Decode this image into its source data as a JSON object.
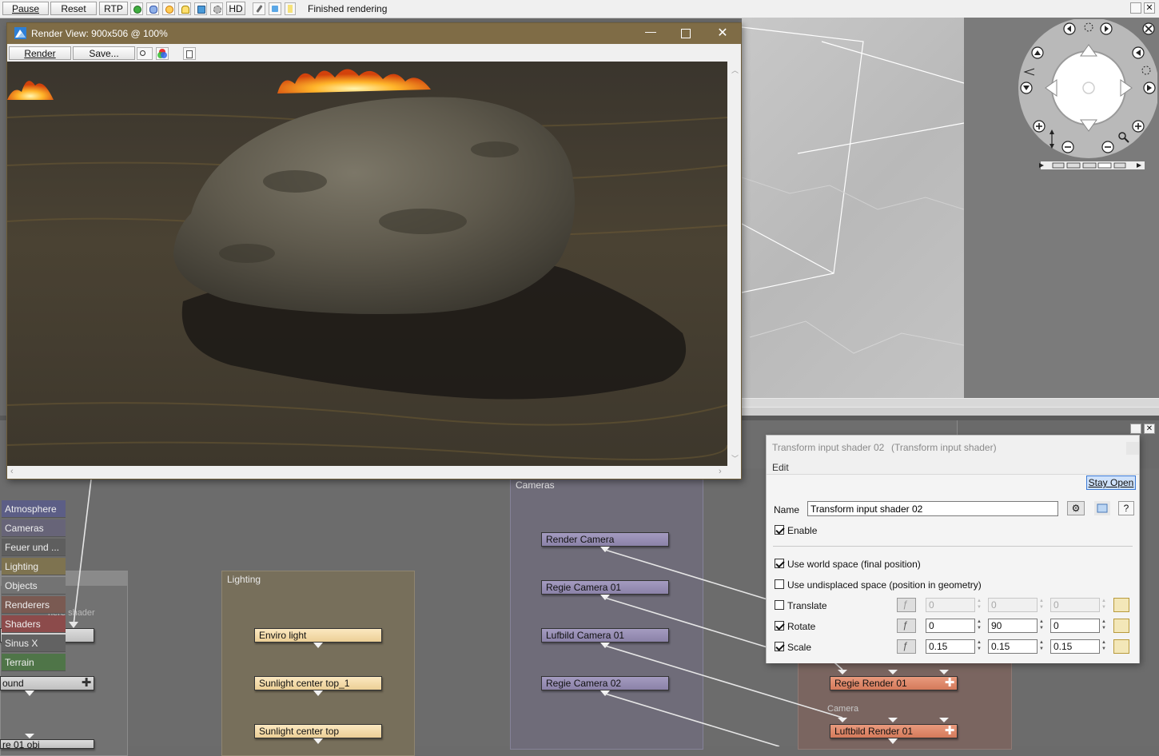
{
  "toolbar": {
    "pause_label": "Pause",
    "reset_label": "Reset",
    "rtp_label": "RTP",
    "hd_label": "HD",
    "status": "Finished rendering",
    "icons": [
      "globe-icon",
      "cloud-icon",
      "sun-icon",
      "light-bulb-icon",
      "material-icon",
      "gear-icon"
    ]
  },
  "render_view": {
    "title": "Render View: 900x506 @ 100%",
    "render_label": "Render",
    "save_label": "Save..."
  },
  "categories": [
    {
      "label": "Atmosphere",
      "color": "#5c5e86"
    },
    {
      "label": "Cameras",
      "color": "#676478"
    },
    {
      "label": "Feuer und ...",
      "color": "#5e5e5e"
    },
    {
      "label": "Lighting",
      "color": "#7e7350"
    },
    {
      "label": "Objects",
      "color": "#737373"
    },
    {
      "label": "Renderers",
      "color": "#7a5a52"
    },
    {
      "label": "Shaders",
      "color": "#8c4b4b"
    },
    {
      "label": "Sinus X",
      "color": "#626262"
    },
    {
      "label": "Terrain",
      "color": "#4f7548"
    }
  ],
  "graph": {
    "left_partial": {
      "overlay": "here shader",
      "node_label": "ound",
      "bottom_partial": "re 01 obj"
    },
    "lighting": {
      "title": "Lighting",
      "nodes": [
        "Enviro light",
        "Sunlight center top_1",
        "Sunlight center top"
      ]
    },
    "cameras": {
      "title": "Cameras",
      "nodes": [
        "Render Camera",
        "Regie Camera 01",
        "Lufbild Camera 01",
        "Regie Camera 02"
      ]
    },
    "renderers": {
      "camera_label": "Camera",
      "nodes": [
        "Regie Render 01",
        "Luftbild Render 01"
      ]
    }
  },
  "props": {
    "title": "Transform input shader 02",
    "type": "(Transform input shader)",
    "menu_edit": "Edit",
    "stay_open_label": "Stay Open",
    "name_label": "Name",
    "name_value": "Transform input shader 02",
    "help_label": "?",
    "enable_label": "Enable",
    "world_space_label": "Use world space (final position)",
    "undisplaced_label": "Use undisplaced space (position in geometry)",
    "translate": {
      "label": "Translate",
      "checked": false,
      "x": "0",
      "y": "0",
      "z": "0"
    },
    "rotate": {
      "label": "Rotate",
      "checked": true,
      "x": "0",
      "y": "90",
      "z": "0"
    },
    "scale": {
      "label": "Scale",
      "checked": true,
      "x": "0.15",
      "y": "0.15",
      "z": "0.15"
    }
  }
}
